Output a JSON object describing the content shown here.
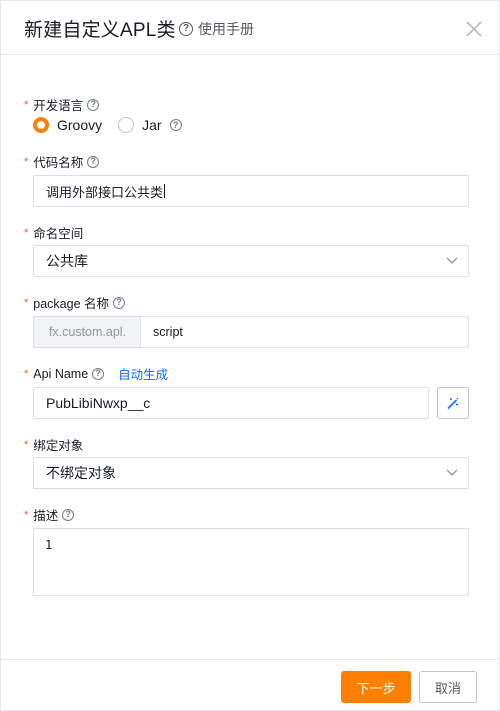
{
  "header": {
    "title": "新建自定义APL类",
    "help_label": "使用手册"
  },
  "form": {
    "language": {
      "label": "开发语言",
      "options": [
        {
          "label": "Groovy",
          "checked": true
        },
        {
          "label": "Jar",
          "checked": false
        }
      ]
    },
    "code_name": {
      "label": "代码名称",
      "value": "调用外部接口公共类"
    },
    "namespace": {
      "label": "命名空间",
      "value": "公共库"
    },
    "package": {
      "label": "package 名称",
      "prefix": "fx.custom.apl.",
      "value": "script"
    },
    "api_name": {
      "label": "Api Name",
      "auto_generate": "自动生成",
      "value": "PubLibiNwxp__c"
    },
    "bind_object": {
      "label": "绑定对象",
      "value": "不绑定对象"
    },
    "description": {
      "label": "描述",
      "line_number": "1"
    }
  },
  "footer": {
    "next_label": "下一步",
    "cancel_label": "取消"
  },
  "colors": {
    "accent": "#ff8000",
    "link": "#0c6cff",
    "required": "#ff522a"
  }
}
